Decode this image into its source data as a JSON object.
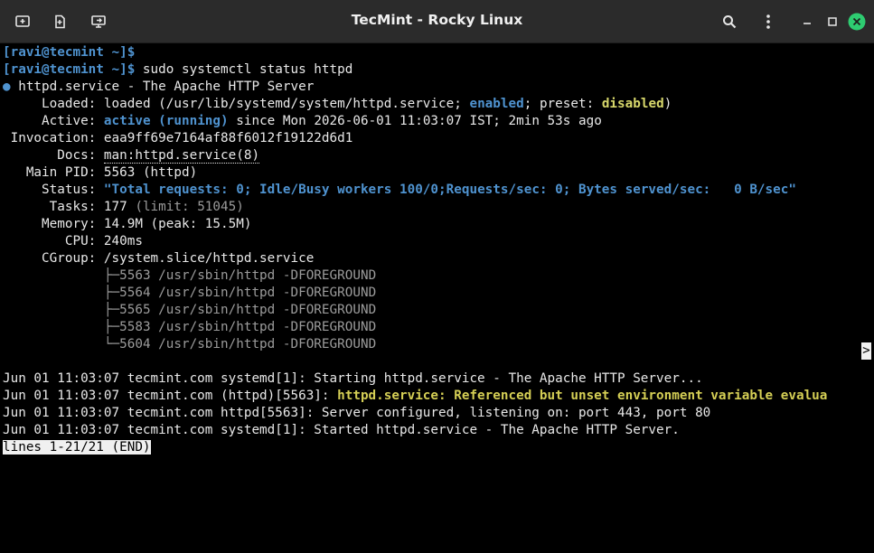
{
  "window": {
    "title": "TecMint - Rocky Linux"
  },
  "icons": {
    "new_tab": "new-tab-icon",
    "split": "split-terminal-icon",
    "export": "export-icon",
    "search": "search-icon",
    "menu": "kebab-menu-icon",
    "minimize": "minimize-icon",
    "maximize": "maximize-icon",
    "close": "close-icon"
  },
  "colors": {
    "close_button": "#2ecc71",
    "accent_blue": "#4f93d0",
    "accent_yellow": "#d7d76b"
  },
  "terminal": {
    "prompt_user": "ravi",
    "prompt_host": "tecmint",
    "prompt_dir": "~",
    "prompt1": "[ravi@tecmint ~]$",
    "prompt2": "[ravi@tecmint ~]$",
    "command": " sudo systemctl status httpd",
    "service_dot": "●",
    "service_line": " httpd.service - The Apache HTTP Server",
    "loaded_label": "     Loaded: ",
    "loaded_pre": "loaded (/usr/lib/systemd/system/httpd.service; ",
    "loaded_enabled": "enabled",
    "loaded_mid": "; preset: ",
    "loaded_preset": "disabled",
    "loaded_post": ")",
    "active_label": "     Active: ",
    "active_state": "active (running)",
    "active_since": " since Mon 2026-06-01 11:03:07 IST; 2min 53s ago",
    "invocation_label": " Invocation: ",
    "invocation_value": "eaa9ff69e7164af88f6012f19122d6d1",
    "docs_label": "       Docs: ",
    "docs_value": "man:httpd.service(8)",
    "pid_label": "   Main PID: ",
    "pid_value": "5563 (httpd)",
    "status_label": "     Status: ",
    "status_value": "\"Total requests: 0; Idle/Busy workers 100/0;Requests/sec: 0; Bytes served/sec:   0 B/sec\"",
    "tasks_label": "      Tasks: ",
    "tasks_value": "177",
    "tasks_limit": " (limit: 51045)",
    "memory_label": "     Memory: ",
    "memory_value": "14.9M (peak: 15.5M)",
    "cpu_label": "        CPU: ",
    "cpu_value": "240ms",
    "cgroup_label": "     CGroup: ",
    "cgroup_value": "/system.slice/httpd.service",
    "processes": [
      {
        "prefix": "             ├─",
        "text": "5563 /usr/sbin/httpd -DFOREGROUND"
      },
      {
        "prefix": "             ├─",
        "text": "5564 /usr/sbin/httpd -DFOREGROUND"
      },
      {
        "prefix": "             ├─",
        "text": "5565 /usr/sbin/httpd -DFOREGROUND"
      },
      {
        "prefix": "             ├─",
        "text": "5583 /usr/sbin/httpd -DFOREGROUND"
      },
      {
        "prefix": "             └─",
        "text": "5604 /usr/sbin/httpd -DFOREGROUND"
      }
    ],
    "log1": "Jun 01 11:03:07 tecmint.com systemd[1]: Starting httpd.service - The Apache HTTP Server...",
    "log2_pre": "Jun 01 11:03:07 tecmint.com (httpd)[5563]: ",
    "log2_msg": "httpd.service: Referenced but unset environment variable evalua",
    "log2_arrow": ">",
    "log3": "Jun 01 11:03:07 tecmint.com httpd[5563]: Server configured, listening on: port 443, port 80",
    "log4": "Jun 01 11:03:07 tecmint.com systemd[1]: Started httpd.service - The Apache HTTP Server.",
    "pager_status": "lines 1-21/21 (END)"
  }
}
